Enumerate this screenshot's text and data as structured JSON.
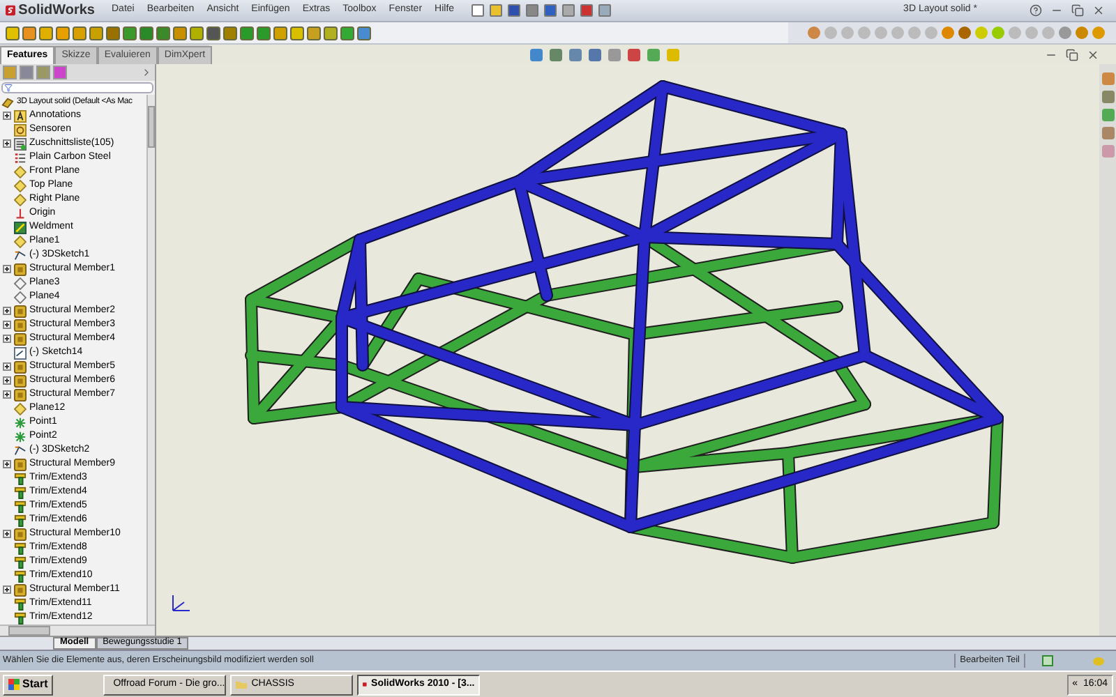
{
  "app": {
    "logo": "SolidWorks"
  },
  "menu": [
    "Datei",
    "Bearbeiten",
    "Ansicht",
    "Einfügen",
    "Extras",
    "Toolbox",
    "Fenster",
    "Hilfe"
  ],
  "window": {
    "title": "3D Layout solid *"
  },
  "panel_tabs": [
    {
      "label": "Features",
      "selected": true
    },
    {
      "label": "Skizze",
      "selected": false
    },
    {
      "label": "Evaluieren",
      "selected": false
    },
    {
      "label": "DimXpert",
      "selected": false
    }
  ],
  "tree": {
    "root": "3D Layout solid  (Default <As Mac",
    "items": [
      {
        "label": "Annotations",
        "kind": "annotation",
        "has_children": true
      },
      {
        "label": "Sensoren",
        "kind": "sensor",
        "has_children": false
      },
      {
        "label": "Zuschnittsliste(105)",
        "kind": "cutlist",
        "has_children": true
      },
      {
        "label": "Plain Carbon Steel",
        "kind": "material",
        "has_children": false
      },
      {
        "label": "Front Plane",
        "kind": "plane",
        "has_children": false
      },
      {
        "label": "Top Plane",
        "kind": "plane",
        "has_children": false
      },
      {
        "label": "Right Plane",
        "kind": "plane",
        "has_children": false
      },
      {
        "label": "Origin",
        "kind": "origin",
        "has_children": false
      },
      {
        "label": "Weldment",
        "kind": "weldment",
        "has_children": false
      },
      {
        "label": "Plane1",
        "kind": "plane",
        "has_children": false
      },
      {
        "label": "(-) 3DSketch1",
        "kind": "sketch3d",
        "has_children": false
      },
      {
        "label": "Structural Member1",
        "kind": "member",
        "has_children": true
      },
      {
        "label": "Plane3",
        "kind": "refplane",
        "has_children": false
      },
      {
        "label": "Plane4",
        "kind": "refplane",
        "has_children": false
      },
      {
        "label": "Structural Member2",
        "kind": "member",
        "has_children": true
      },
      {
        "label": "Structural Member3",
        "kind": "member",
        "has_children": true
      },
      {
        "label": "Structural Member4",
        "kind": "member",
        "has_children": true
      },
      {
        "label": "(-) Sketch14",
        "kind": "sketch",
        "has_children": false
      },
      {
        "label": "Structural Member5",
        "kind": "member",
        "has_children": true
      },
      {
        "label": "Structural Member6",
        "kind": "member",
        "has_children": true
      },
      {
        "label": "Structural Member7",
        "kind": "member",
        "has_children": true
      },
      {
        "label": "Plane12",
        "kind": "plane",
        "has_children": false
      },
      {
        "label": "Point1",
        "kind": "point",
        "has_children": false
      },
      {
        "label": "Point2",
        "kind": "point",
        "has_children": false
      },
      {
        "label": "(-) 3DSketch2",
        "kind": "sketch3d",
        "has_children": false
      },
      {
        "label": "Structural Member9",
        "kind": "member",
        "has_children": true
      },
      {
        "label": "Trim/Extend3",
        "kind": "trim",
        "has_children": false
      },
      {
        "label": "Trim/Extend4",
        "kind": "trim",
        "has_children": false
      },
      {
        "label": "Trim/Extend5",
        "kind": "trim",
        "has_children": false
      },
      {
        "label": "Trim/Extend6",
        "kind": "trim",
        "has_children": false
      },
      {
        "label": "Structural Member10",
        "kind": "member",
        "has_children": true
      },
      {
        "label": "Trim/Extend8",
        "kind": "trim",
        "has_children": false
      },
      {
        "label": "Trim/Extend9",
        "kind": "trim",
        "has_children": false
      },
      {
        "label": "Trim/Extend10",
        "kind": "trim",
        "has_children": false
      },
      {
        "label": "Structural Member11",
        "kind": "member",
        "has_children": true
      },
      {
        "label": "Trim/Extend11",
        "kind": "trim",
        "has_children": false
      },
      {
        "label": "Trim/Extend12",
        "kind": "trim",
        "has_children": false
      }
    ]
  },
  "model_tabs": [
    {
      "label": "Modell",
      "selected": true
    },
    {
      "label": "Bewegungsstudie 1",
      "selected": false
    }
  ],
  "status_bar": {
    "message": "Wählen Sie die Elemente aus, deren Erscheinungsbild modifiziert werden soll",
    "mode": "Bearbeiten Teil"
  },
  "taskbar": {
    "start": "Start",
    "items": [
      {
        "label": "Offroad Forum - Die gro...",
        "kind": "browser",
        "selected": false
      },
      {
        "label": "CHASSIS",
        "kind": "folder",
        "selected": false
      },
      {
        "label": "SolidWorks 2010 - [3...",
        "kind": "app",
        "selected": true
      }
    ],
    "tray_toggle": "«",
    "clock": "16:04"
  }
}
